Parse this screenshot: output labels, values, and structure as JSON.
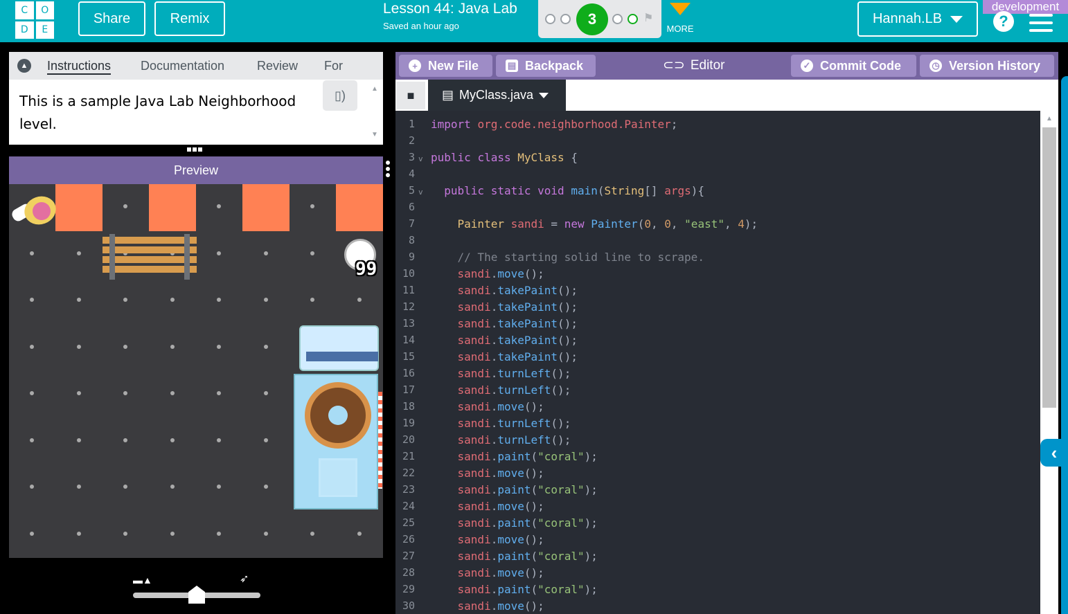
{
  "header": {
    "logo_letters": [
      "C",
      "O",
      "D",
      "E"
    ],
    "share_label": "Share",
    "remix_label": "Remix",
    "lesson_title": "Lesson 44: Java Lab",
    "saved_status": "Saved an hour ago",
    "current_level": "3",
    "more_label": "MORE",
    "username": "Hannah.LB",
    "environment_badge": "development",
    "help_label": "?"
  },
  "instructions": {
    "tabs": [
      "Instructions",
      "Documentation",
      "Review",
      "For"
    ],
    "active_tab": "Instructions",
    "text": "This is a sample Java Lab Neighborhood level."
  },
  "preview": {
    "title": "Preview",
    "paint_count": "99",
    "speed_level": 0.5
  },
  "editor": {
    "new_file_label": "New File",
    "backpack_label": "Backpack",
    "editor_label": "Editor",
    "commit_label": "Commit Code",
    "version_history_label": "Version History",
    "file_name": "MyClass.java",
    "lines": [
      "import org.code.neighborhood.Painter;",
      "",
      "public class MyClass {",
      "",
      "  public static void main(String[] args){",
      "",
      "    Painter sandi = new Painter(0, 0, \"east\", 4);",
      "",
      "    // The starting solid line to scrape.",
      "    sandi.move();",
      "    sandi.takePaint();",
      "    sandi.takePaint();",
      "    sandi.takePaint();",
      "    sandi.takePaint();",
      "    sandi.takePaint();",
      "    sandi.turnLeft();",
      "    sandi.turnLeft();",
      "    sandi.move();",
      "    sandi.turnLeft();",
      "    sandi.turnLeft();",
      "    sandi.paint(\"coral\");",
      "    sandi.move();",
      "    sandi.paint(\"coral\");",
      "    sandi.move();",
      "    sandi.paint(\"coral\");",
      "    sandi.move();",
      "    sandi.paint(\"coral\");",
      "    sandi.move();",
      "    sandi.paint(\"coral\");",
      "    sandi.move();"
    ],
    "foldable_lines": [
      3,
      5
    ]
  },
  "colors": {
    "header_bg": "#00adbc",
    "toolbar_purple": "#7665a0",
    "level_green": "#0fad1b",
    "more_orange": "#ffa400",
    "coral": "#ff8154",
    "dev_badge": "#b38ad8",
    "editor_bg": "#282c34"
  }
}
